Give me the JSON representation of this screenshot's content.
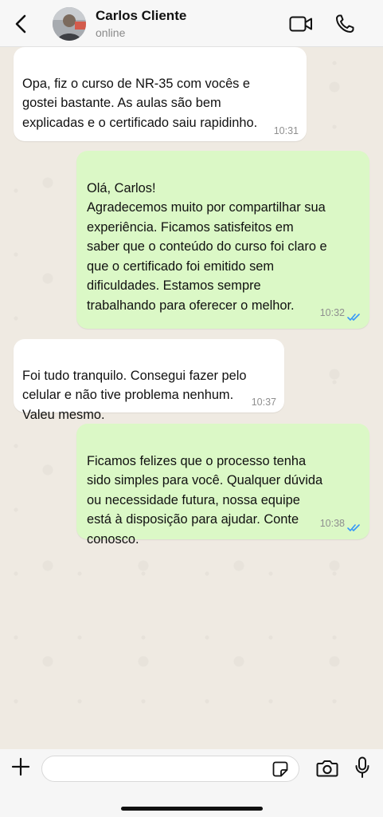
{
  "header": {
    "contact_name": "Carlos Cliente",
    "status": "online",
    "icons": {
      "back": "chevron-left-icon",
      "video": "video-call-icon",
      "phone": "phone-call-icon"
    }
  },
  "messages": [
    {
      "direction": "incoming",
      "text": "Opa, fiz o curso de NR-35 com vocês e\ngostei bastante. As aulas são bem\nexplicadas e o certificado saiu rapidinho.",
      "time": "10:31"
    },
    {
      "direction": "outgoing",
      "text": "Olá, Carlos!\nAgradecemos muito por compartilhar sua\nexperiência. Ficamos satisfeitos em\nsaber que o conteúdo do curso foi claro e\nque o certificado foi emitido sem\ndificuldades. Estamos sempre\ntrabalhando para oferecer o melhor.",
      "time": "10:32",
      "read": true
    },
    {
      "direction": "incoming",
      "text": "Foi tudo tranquilo. Consegui fazer pelo\ncelular e não tive problema nenhum.\nValeu mesmo.",
      "time": "10:37"
    },
    {
      "direction": "outgoing",
      "text": "Ficamos felizes que o processo tenha\nsido simples para você. Qualquer dúvida\nou necessidade futura, nossa equipe\nestá à disposição para ajudar. Conte\nconosco.",
      "time": "10:38",
      "read": true
    }
  ],
  "composer": {
    "value": "",
    "placeholder": "",
    "icons": {
      "attach": "plus-icon",
      "sticker": "sticker-icon",
      "camera": "camera-icon",
      "mic": "microphone-icon"
    }
  },
  "colors": {
    "background": "#efeae2",
    "incoming_bubble": "#ffffff",
    "outgoing_bubble": "#dbf8c6",
    "read_ticks": "#3497f9",
    "header": "#f7f7f7"
  }
}
